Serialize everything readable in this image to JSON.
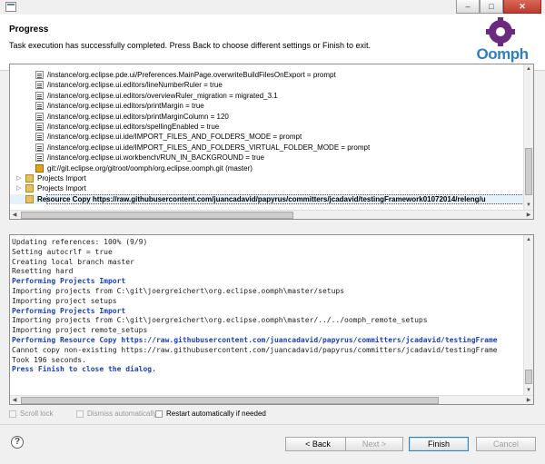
{
  "window": {
    "controls": [
      "minimize",
      "maximize",
      "close"
    ],
    "controls_glyphs": [
      "–",
      "□",
      "✕"
    ]
  },
  "header": {
    "title": "Progress",
    "subtitle": "Task execution has successfully completed.  Press Back to choose different settings or Finish to exit.",
    "logo_text": "Oomph",
    "logo_color": "#2e7fc0",
    "logo_gear_color": "#6a2a7f"
  },
  "tree": {
    "rows": [
      {
        "icon": "pref",
        "indent": 2,
        "text": "/instance/org.eclipse.pde.ui/Preferences.MainPage.overwriteBuildFilesOnExport = prompt"
      },
      {
        "icon": "pref",
        "indent": 2,
        "text": "/instance/org.eclipse.ui.editors/lineNumberRuler = true"
      },
      {
        "icon": "pref",
        "indent": 2,
        "text": "/instance/org.eclipse.ui.editors/overviewRuler_migration = migrated_3.1"
      },
      {
        "icon": "pref",
        "indent": 2,
        "text": "/instance/org.eclipse.ui.editors/printMargin = true"
      },
      {
        "icon": "pref",
        "indent": 2,
        "text": "/instance/org.eclipse.ui.editors/printMarginColumn = 120"
      },
      {
        "icon": "pref",
        "indent": 2,
        "text": "/instance/org.eclipse.ui.editors/spellingEnabled = true"
      },
      {
        "icon": "pref",
        "indent": 2,
        "text": "/instance/org.eclipse.ui.ide/IMPORT_FILES_AND_FOLDERS_MODE = prompt"
      },
      {
        "icon": "pref",
        "indent": 2,
        "text": "/instance/org.eclipse.ui.ide/IMPORT_FILES_AND_FOLDERS_VIRTUAL_FOLDER_MODE = prompt"
      },
      {
        "icon": "pref",
        "indent": 2,
        "text": "/instance/org.eclipse.ui.workbench/RUN_IN_BACKGROUND = true"
      },
      {
        "icon": "git",
        "indent": 2,
        "text": "git://git.eclipse.org/gitroot/oomph/org.eclipse.oomph.git  (master)"
      },
      {
        "icon": "folder",
        "indent": 1,
        "arrow": "▷",
        "text": "Projects Import"
      },
      {
        "icon": "folder",
        "indent": 1,
        "arrow": "▷",
        "text": "Projects Import"
      },
      {
        "icon": "folder",
        "indent": 1,
        "text": "Resource Copy https://raw.githubusercontent.com/juancadavid/papyrus/committers/jcadavid/testingFramework01072014/releng/u",
        "selected": true
      }
    ]
  },
  "console": {
    "lines": [
      {
        "style": "normal",
        "text": "Updating references:      100% (9/9)"
      },
      {
        "style": "normal",
        "text": "Setting autocrlf = true"
      },
      {
        "style": "normal",
        "text": "Creating local branch master"
      },
      {
        "style": "normal",
        "text": "Resetting hard"
      },
      {
        "style": "blue",
        "text": "Performing Projects Import"
      },
      {
        "style": "normal",
        "text": "Importing projects from C:\\git\\joergreichert\\org.eclipse.oomph\\master/setups"
      },
      {
        "style": "normal",
        "text": "Importing project setups"
      },
      {
        "style": "blue",
        "text": "Performing Projects Import"
      },
      {
        "style": "normal",
        "text": "Importing projects from C:\\git\\joergreichert\\org.eclipse.oomph\\master/../../oomph_remote_setups"
      },
      {
        "style": "normal",
        "text": "Importing project remote_setups"
      },
      {
        "style": "blue",
        "text": "Performing Resource Copy https://raw.githubusercontent.com/juancadavid/papyrus/committers/jcadavid/testingFrame"
      },
      {
        "style": "normal",
        "text": "Cannot copy non-existing https://raw.githubusercontent.com/juancadavid/papyrus/committers/jcadavid/testingFrame"
      },
      {
        "style": "normal",
        "text": "Took 196 seconds."
      },
      {
        "style": "blue",
        "text": "Press Finish to close the dialog."
      }
    ]
  },
  "options": {
    "scroll_lock": "Scroll lock",
    "dismiss_automatically": "Dismiss automatically",
    "restart_automatically": "Restart automatically if needed"
  },
  "buttons": {
    "help": "?",
    "back": "< Back",
    "next": "Next >",
    "finish": "Finish",
    "cancel": "Cancel"
  },
  "colors": {
    "console_highlight": "#1a3fbf",
    "selection_background": "#e5f1fb",
    "default_button_border": "#3c7fb1"
  }
}
